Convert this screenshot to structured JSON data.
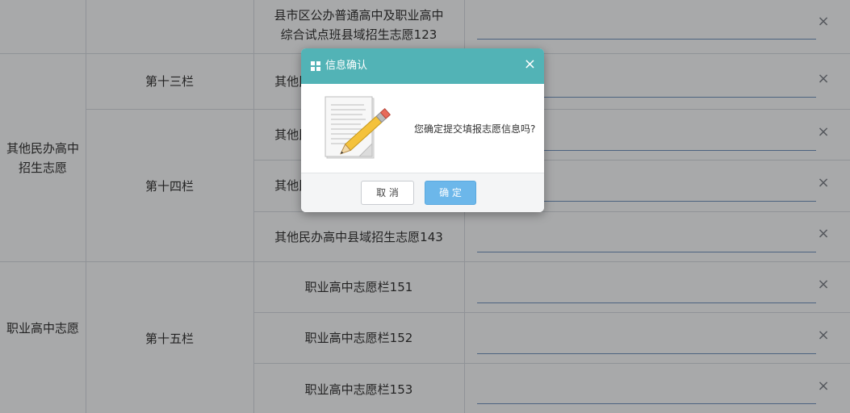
{
  "rows": [
    {
      "label": "县市区公办普通高中及职业高中",
      "label2": "综合试点班县域招生志愿123"
    },
    {
      "label": "其他民办高中县域招生志愿131"
    },
    {
      "label": "其他民办高中县域招生志愿141"
    },
    {
      "label": "其他民办高中县域招生志愿142"
    },
    {
      "label": "其他民办高中县域招生志愿143"
    },
    {
      "label": "职业高中志愿栏151"
    },
    {
      "label": "职业高中志愿栏152"
    },
    {
      "label": "职业高中志愿栏153"
    }
  ],
  "columns": {
    "col13": "第十三栏",
    "col14": "第十四栏",
    "col15": "第十五栏"
  },
  "groups": {
    "private": "其他民办高中招生志愿",
    "vocational": "职业高中志愿"
  },
  "clear_glyph": "×",
  "dialog": {
    "title": "信息确认",
    "close_glyph": "×",
    "message": "您确定提交填报志愿信息吗?",
    "cancel_label": "取 消",
    "ok_label": "确 定"
  }
}
